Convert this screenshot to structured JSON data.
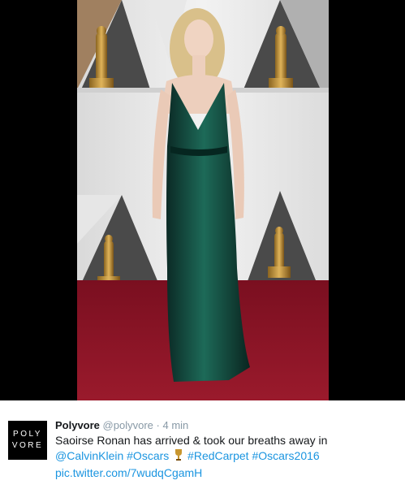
{
  "photo": {
    "alt_subject": "red-carpet-photo"
  },
  "tweet": {
    "avatar": {
      "line1": "POLY",
      "line2": "VORE"
    },
    "display_name": "Polyvore",
    "handle": "@polyvore",
    "separator": "·",
    "time": "4 min",
    "text_line1": "Saoirse Ronan has arrived & took our breaths away in",
    "mention": "@CalvinKlein",
    "hashtag1": "#Oscars",
    "trophy_emoji": "trophy-icon",
    "hashtag2": "#RedCarpet",
    "hashtag3": "#Oscars2016",
    "pic_link": "pic.twitter.com/7wudqCgamH"
  },
  "colors": {
    "link": "#1b95e0",
    "carpet": "#8b1426",
    "gown": "#0f3a32"
  }
}
